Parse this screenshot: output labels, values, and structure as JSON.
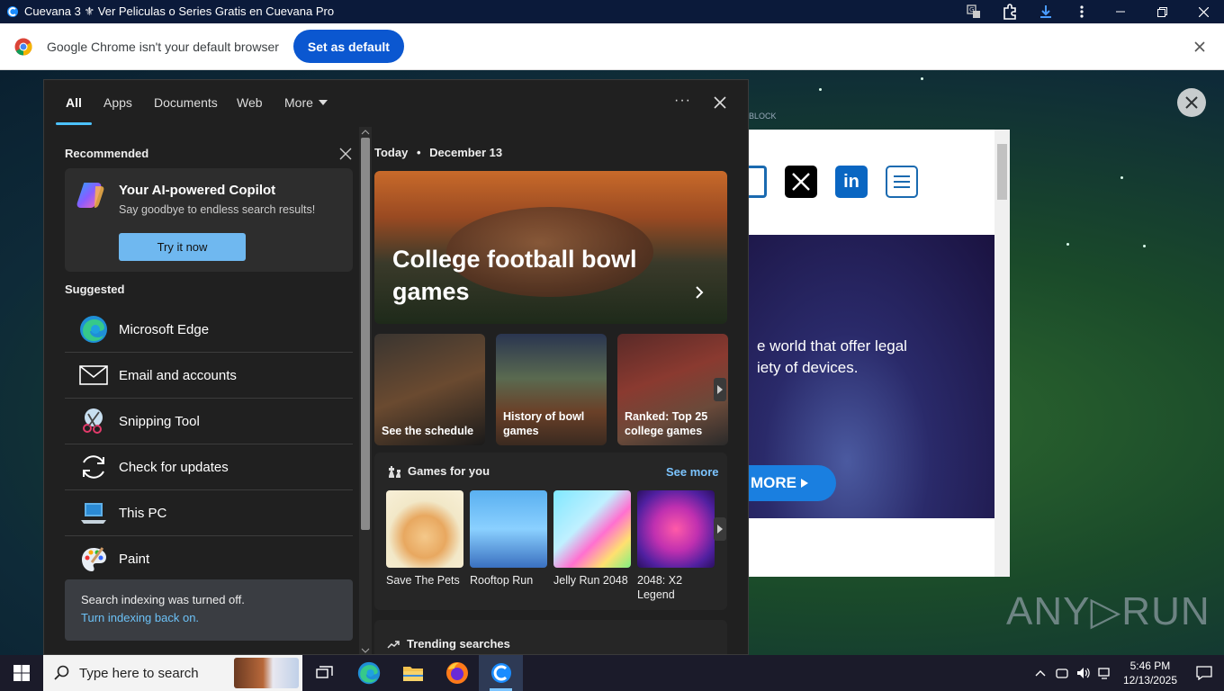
{
  "titlebar": {
    "title": "Cuevana 3 ⚜ Ver Peliculas o Series Gratis en Cuevana Pro"
  },
  "infobar": {
    "message": "Google Chrome isn't your default browser",
    "button": "Set as default"
  },
  "background_page": {
    "block_label": "BLOCK",
    "banner_text_line1": "e world that offer legal",
    "banner_text_line2": "iety of devices.",
    "more_button": "MORE",
    "watermark": "ANY▷RUN"
  },
  "panel": {
    "tabs": [
      "All",
      "Apps",
      "Documents",
      "Web",
      "More"
    ],
    "active_tab": "All",
    "recommended": {
      "title": "Recommended",
      "copilot_title": "Your AI-powered Copilot",
      "copilot_subtitle": "Say goodbye to endless search results!",
      "copilot_button": "Try it now"
    },
    "suggested_title": "Suggested",
    "apps": [
      {
        "label": "Microsoft Edge",
        "icon": "edge-icon"
      },
      {
        "label": "Email and accounts",
        "icon": "mail-icon"
      },
      {
        "label": "Snipping Tool",
        "icon": "snipping-tool-icon"
      },
      {
        "label": "Check for updates",
        "icon": "update-icon"
      },
      {
        "label": "This PC",
        "icon": "computer-icon"
      },
      {
        "label": "Paint",
        "icon": "paint-icon"
      }
    ],
    "indexing": {
      "line1": "Search indexing was turned off.",
      "link": "Turn indexing back on."
    },
    "today": {
      "label": "Today",
      "date": "December 13"
    },
    "hero_title": "College football bowl games",
    "tiles": [
      {
        "title": "See the schedule"
      },
      {
        "title": "History of bowl games"
      },
      {
        "title": "Ranked: Top 25 college games"
      }
    ],
    "games": {
      "title": "Games for you",
      "see_more": "See more",
      "items": [
        {
          "label": "Save The Pets"
        },
        {
          "label": "Rooftop Run"
        },
        {
          "label": "Jelly Run 2048"
        },
        {
          "label": "2048: X2 Legend"
        }
      ]
    },
    "trending_title": "Trending searches"
  },
  "taskbar": {
    "search_placeholder": "Type here to search",
    "time": "5:46 PM",
    "date": "12/13/2025"
  },
  "colors": {
    "accent": "#4cc2ff",
    "chrome_button": "#0b57d0",
    "panel_bg": "#202020",
    "link": "#6cc1f6"
  }
}
